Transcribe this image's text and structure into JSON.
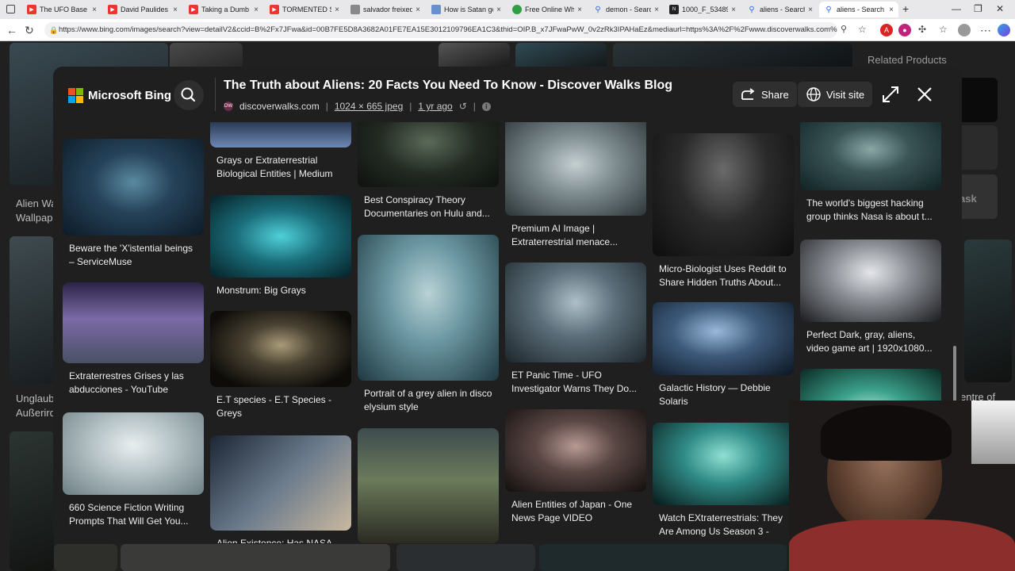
{
  "browser": {
    "tabs": [
      {
        "title": "The UFO Base N",
        "icon": "youtube-icon",
        "color": "#e33"
      },
      {
        "title": "David Paulides",
        "icon": "youtube-icon",
        "color": "#e33"
      },
      {
        "title": "Taking a Dumb o",
        "icon": "youtube-icon",
        "color": "#e33"
      },
      {
        "title": "TORMENTED SO",
        "icon": "youtube-icon",
        "color": "#e33"
      },
      {
        "title": "salvador freixed",
        "icon": "page-icon",
        "color": "#888"
      },
      {
        "title": "How is Satan go",
        "icon": "page-icon",
        "color": "#6a8fd0"
      },
      {
        "title": "Free Online Whi",
        "icon": "page-icon",
        "color": "#2f9e44"
      },
      {
        "title": "demon - Search",
        "icon": "search-icon",
        "color": "#2d6cdf"
      },
      {
        "title": "1000_F_534894",
        "icon": "page-icon",
        "color": "#222"
      },
      {
        "title": "aliens - Search",
        "icon": "search-icon",
        "color": "#2d6cdf"
      },
      {
        "title": "aliens - Search in",
        "icon": "search-icon",
        "color": "#2d6cdf"
      }
    ],
    "url": "https://www.bing.com/images/search?view=detailV2&ccid=B%2Fx7JFwa&id=00B7FE5D8A3682A01FE7EA15E3012109796EA1C3&thid=OIP.B_x7JFwaPwW_0v2zRk3IPAHaEz&mediaurl=https%3A%2F%2Fwww.discoverwalks.com%2Fblog%..."
  },
  "background": {
    "related_label": "Related Products",
    "left_texts": [
      "Alien Wa",
      "Wallpap",
      "Unglaub",
      "Außerird"
    ],
    "right_texts": [
      "entre of",
      "ask"
    ]
  },
  "modal": {
    "brand": "Microsoft Bing",
    "title": "The Truth about Aliens: 20 Facts You Need To Know - Discover Walks Blog",
    "source": "discoverwalks.com",
    "dimensions": "1024 × 665 jpeg",
    "age": "1 yr ago",
    "share_label": "Share",
    "visit_label": "Visit site"
  },
  "results": [
    {
      "caption": "Beware the 'X'istential beings – ServiceMuse"
    },
    {
      "caption": "Extraterrestres Grises y las abducciones - YouTube"
    },
    {
      "caption": "660 Science Fiction Writing Prompts That Will Get You..."
    },
    {
      "caption": "Grays or Extraterrestrial Biological Entities | Medium"
    },
    {
      "caption": "Monstrum: Big Grays"
    },
    {
      "caption": "E.T species - E.T Species - Greys"
    },
    {
      "caption": "Alien Existence: Has NASA..."
    },
    {
      "caption": "Best Conspiracy Theory Documentaries on Hulu and..."
    },
    {
      "caption": "Portrait of a grey alien in disco elysium style"
    },
    {
      "caption": "Premium AI Image | Extraterrestrial menace..."
    },
    {
      "caption": "ET Panic Time - UFO Investigator Warns They Do..."
    },
    {
      "caption": "Alien Entities of Japan - One News Page VIDEO"
    },
    {
      "caption": "Micro-Biologist Uses Reddit to Share Hidden Truths About..."
    },
    {
      "caption": "Galactic History — Debbie Solaris"
    },
    {
      "caption": "Watch EXtraterrestrials: They Are Among Us Season 3 - Fr..."
    },
    {
      "caption": "The world's biggest hacking group thinks Nasa is about t..."
    },
    {
      "caption": "Perfect Dark, gray, aliens, video game art | 1920x1080..."
    }
  ]
}
